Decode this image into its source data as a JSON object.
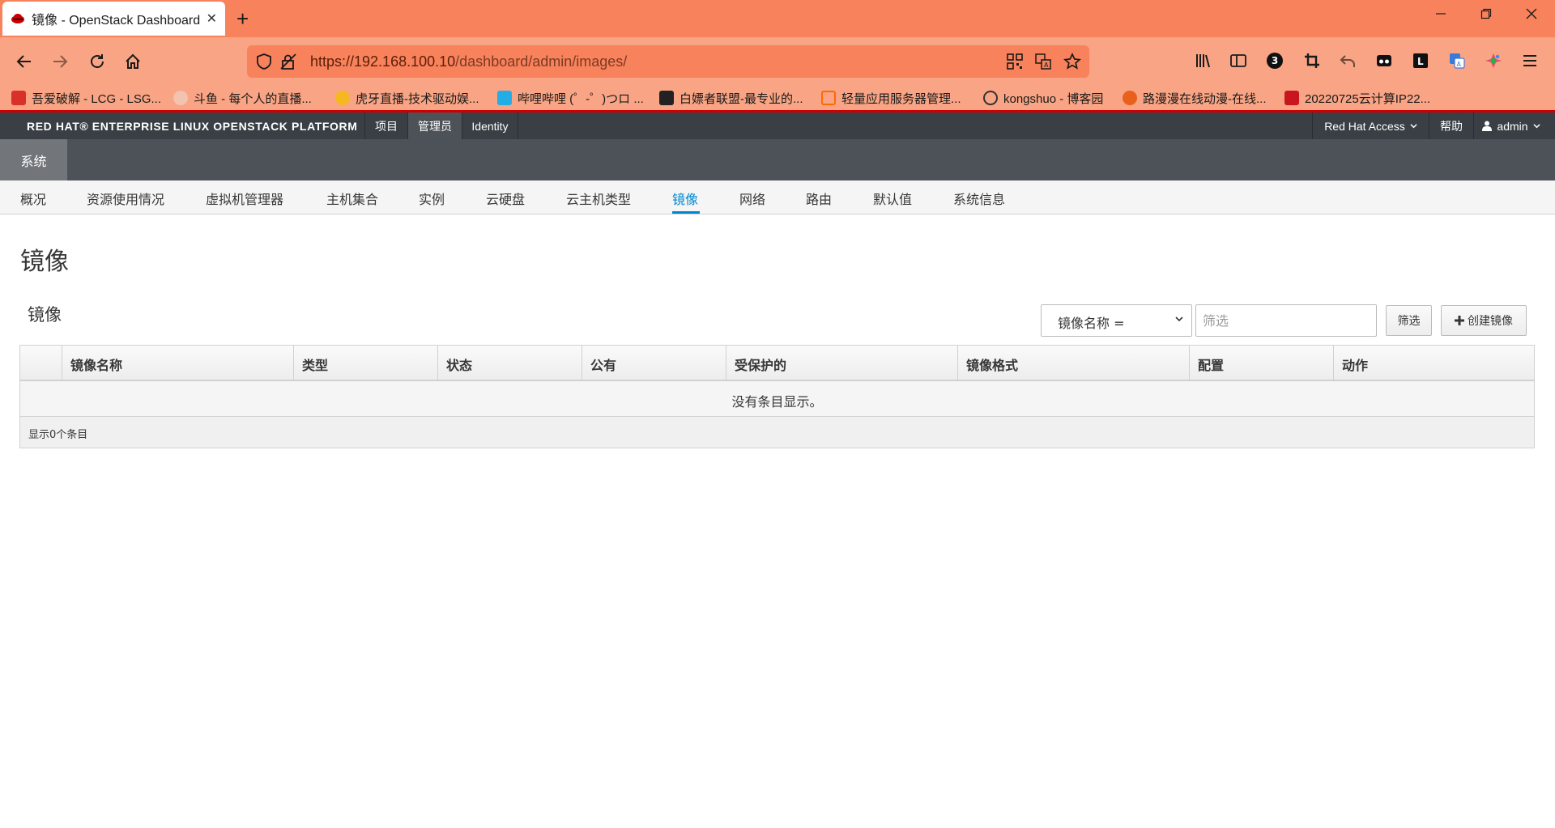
{
  "browser": {
    "tab_title": "镜像 - OpenStack Dashboard",
    "tab_close": "✕",
    "new_tab": "+",
    "url_host": "https://192.168.100.10",
    "url_path": "/dashboard/admin/images/",
    "extension_badge": "3",
    "bookmarks": [
      {
        "label": "吾爱破解 - LCG - LSG...",
        "color": "#d9302a"
      },
      {
        "label": "斗鱼 - 每个人的直播...",
        "color": "#f8a484"
      },
      {
        "label": "虎牙直播-技术驱动娱...",
        "color": "#f5b820"
      },
      {
        "label": "哔哩哔哩 (゜-゜)つロ ...",
        "color": "#23ade5"
      },
      {
        "label": "白嫖者联盟-最专业的...",
        "color": "#222222"
      },
      {
        "label": "轻量应用服务器管理...",
        "color": "#ff6a00"
      },
      {
        "label": "kongshuo - 博客园",
        "color": "#f8a484"
      },
      {
        "label": "路漫漫在线动漫-在线...",
        "color": "#e8601c"
      },
      {
        "label": "20220725云计算IP22...",
        "color": "#c9151e"
      }
    ]
  },
  "header": {
    "brand": "RED HAT® ENTERPRISE LINUX OPENSTACK PLATFORM",
    "nav": [
      "项目",
      "管理员",
      "Identity"
    ],
    "active_nav": "管理员",
    "red_hat_access": "Red Hat Access",
    "help": "帮助",
    "user": "admin"
  },
  "subheader": {
    "system": "系统"
  },
  "panel_nav": {
    "items": [
      "概况",
      "资源使用情况",
      "虚拟机管理器",
      "主机集合",
      "实例",
      "云硬盘",
      "云主机类型",
      "镜像",
      "网络",
      "路由",
      "默认值",
      "系统信息"
    ],
    "active": "镜像"
  },
  "page": {
    "title": "镜像",
    "table_title": "镜像",
    "filter_select": "镜像名称 =",
    "filter_placeholder": "筛选",
    "filter_button": "筛选",
    "create_button": "创建镜像"
  },
  "table": {
    "columns": [
      "镜像名称",
      "类型",
      "状态",
      "公有",
      "受保护的",
      "镜像格式",
      "配置",
      "动作"
    ],
    "empty_message": "没有条目显示。",
    "footer": "显示0个条目"
  },
  "colors": {
    "chrome_tab_bar": "#f8825b",
    "chrome_toolbar": "#f9a484",
    "os_header": "#393f44",
    "active_link": "#0088ce"
  }
}
